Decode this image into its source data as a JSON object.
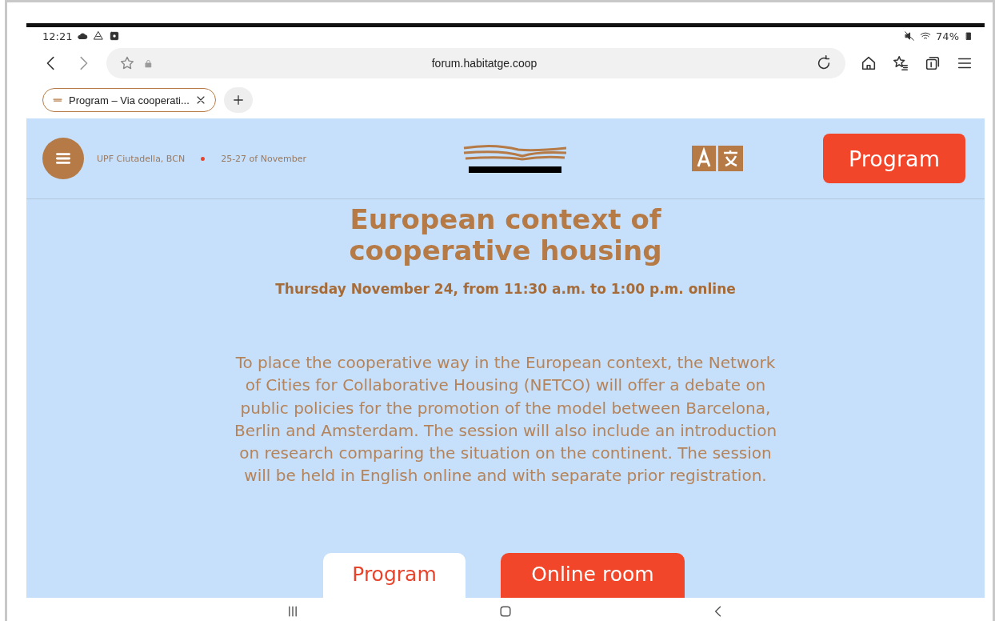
{
  "status_bar": {
    "time": "12:21",
    "battery": "74%"
  },
  "browser": {
    "url": "forum.habitatge.coop",
    "tabs": [
      {
        "title": "Program – Via cooperati...",
        "selected": true
      }
    ]
  },
  "site_header": {
    "location": "UPF Ciutadella, BCN",
    "dates": "25-27 of November",
    "cta": "Program"
  },
  "event": {
    "title": "European context of cooperative housing",
    "when": "Thursday November 24, from 11:30 a.m. to 1:00 p.m. online",
    "description": "To place the cooperative way in the European context, the Network of Cities for Collaborative Housing (NETCO) will offer a debate on public policies for the promotion of the model between Barcelona, Berlin and Amsterdam. The session will also include an introduction on research comparing the situation on the continent. The session will be held in English online and with separate prior registration."
  },
  "actions": [
    {
      "label": "Program",
      "kind": "secondary"
    },
    {
      "label": "Online room",
      "kind": "primary"
    }
  ]
}
